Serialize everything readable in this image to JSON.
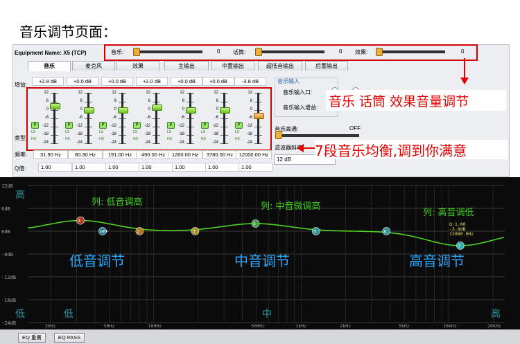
{
  "page_title": "音乐调节页面：",
  "window": {
    "equipment_name": "Equipment Name: X5 (TCP)"
  },
  "top_sliders": [
    {
      "label": "音乐:",
      "value": "0",
      "level": 0
    },
    {
      "label": "话筒:",
      "value": "0",
      "level": 0
    },
    {
      "label": "效果:",
      "value": "0",
      "level": 0
    }
  ],
  "tabs": [
    "音乐",
    "麦克风",
    "效果",
    "主输出",
    "中置输出",
    "超低音输出",
    "后置输出"
  ],
  "active_tab": "音乐",
  "row_labels": {
    "gain": "增益:",
    "type": "类型:",
    "freq": "频率:",
    "q": "Q值:"
  },
  "channels": [
    {
      "gain": "+2.8 dB",
      "freq": "31.90 Hz",
      "q": "1.00",
      "level_db": 2.8,
      "type_tags": [
        "P",
        "LS",
        "HS"
      ]
    },
    {
      "gain": "+0.0 dB",
      "freq": "80.30 Hz",
      "q": "1.00",
      "level_db": 0.0,
      "type_tags": [
        "P",
        "LS",
        "HS"
      ]
    },
    {
      "gain": "+0.0 dB",
      "freq": "191.00 Hz",
      "q": "1.00",
      "level_db": 0.0,
      "type_tags": [
        "P",
        "LS",
        "HS"
      ]
    },
    {
      "gain": "+2.0 dB",
      "freq": "490.00 Hz",
      "q": "1.00",
      "level_db": 2.0,
      "type_tags": [
        "P",
        "LS",
        "HS"
      ]
    },
    {
      "gain": "+0.0 dB",
      "freq": "1260.00 Hz",
      "q": "1.00",
      "level_db": 0.0,
      "type_tags": [
        "P",
        "LS",
        "HS"
      ]
    },
    {
      "gain": "+0.0 dB",
      "freq": "3780.00 Hz",
      "q": "1.00",
      "level_db": 0.0,
      "type_tags": [
        "P",
        "LS",
        "HS"
      ]
    },
    {
      "gain": "-3.8 dB",
      "freq": "12000.00 Hz",
      "q": "1.00",
      "level_db": -3.8,
      "type_tags": [
        "P",
        "LS",
        "HS"
      ]
    }
  ],
  "eq_scale": [
    "12",
    "6",
    "0",
    "-6",
    "-12",
    "-18",
    "-24"
  ],
  "music_input": {
    "group_title": "音乐输入",
    "input_label": "音乐输入口:",
    "radio_options": [
      "1",
      "2"
    ],
    "gain_label": "音乐输入增益:",
    "highpass_label": "音乐高通:",
    "highpass_value": "OFF",
    "slope_label": "滤波器斜率",
    "slope_value": "12 dB"
  },
  "annotations": {
    "top": "音乐 话筒 效果音量调节",
    "eq": "7段音乐均衡,调到你满意"
  },
  "graph": {
    "y_labels": [
      "12dB",
      "6dB",
      "0dB",
      "-6dB",
      "-12dB",
      "-18dB",
      "-24dB"
    ],
    "x_labels": [
      "20Hz",
      "50Hz",
      "100Hz",
      "500Hz",
      "1kHz",
      "2kHz",
      "5kHz",
      "10kHz",
      "20kHz"
    ],
    "high_label": "高",
    "low_label": "低",
    "low_label2": "低",
    "mid_label": "中",
    "high_label2": "高",
    "callouts": [
      "列: 低音调高",
      "列: 中音微调高",
      "列: 高音调低"
    ],
    "band_titles": [
      "低音调节",
      "中音调节",
      "高音调节"
    ],
    "node_labels": [
      "HPF",
      "1",
      "2",
      "3",
      "4",
      "5",
      "6",
      "7"
    ],
    "node_info": [
      "Q:1.00",
      "-3.8dB",
      "12000.0Hz"
    ]
  },
  "bottom_buttons": [
    "EQ 重置",
    "EQ PASS"
  ],
  "colors": {
    "highlight_red": "#d30000",
    "eq_green": "#3fd11b",
    "curve": "#4fd21f",
    "annotation_red": "#e30000"
  }
}
